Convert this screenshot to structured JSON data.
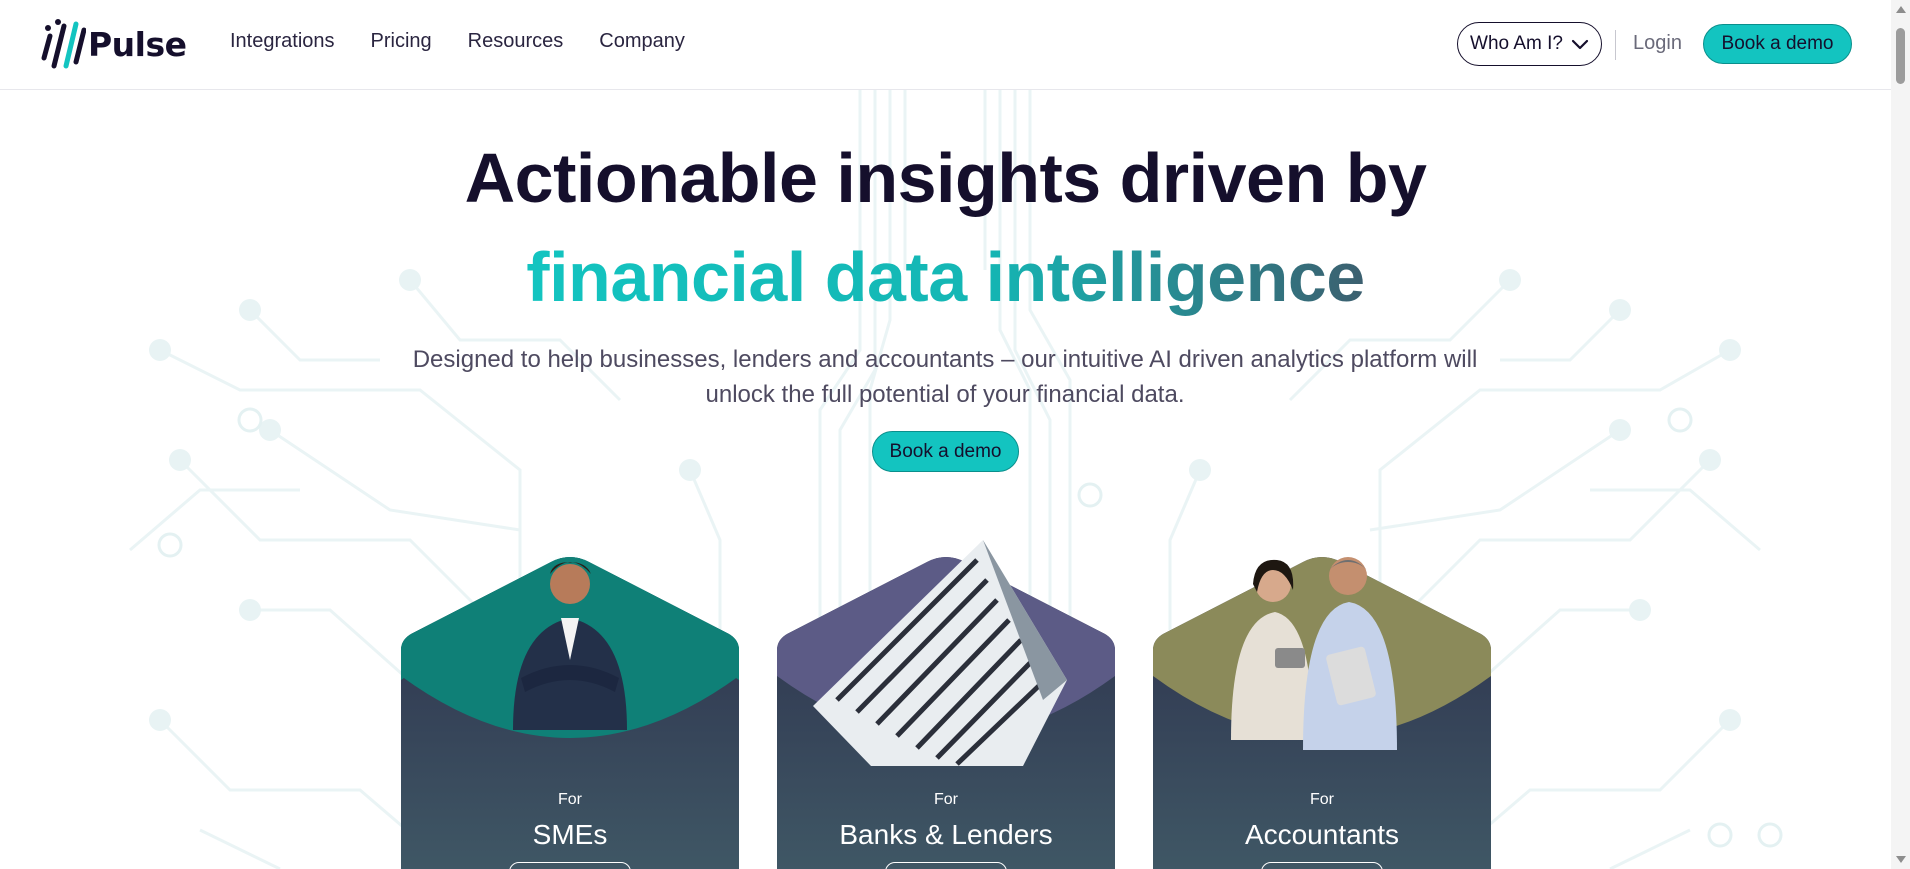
{
  "brand": {
    "name": "Pulse"
  },
  "nav": {
    "links": [
      "Integrations",
      "Pricing",
      "Resources",
      "Company"
    ],
    "who_am_i": "Who Am I?",
    "login": "Login",
    "book_demo": "Book a demo"
  },
  "hero": {
    "title_line1": "Actionable insights driven by",
    "title_line2": "financial data intelligence",
    "subtitle_line1": "Designed to help businesses, lenders and accountants – our intuitive AI driven analytics platform will",
    "subtitle_line2": "unlock the full potential of your financial data.",
    "book_demo": "Book a demo"
  },
  "cards": [
    {
      "for": "For",
      "name": "SMEs",
      "accent": "#0f8077"
    },
    {
      "for": "For",
      "name": "Banks & Lenders",
      "accent": "#5c5b86"
    },
    {
      "for": "For",
      "name": "Accountants",
      "accent": "#8b8a5a"
    }
  ],
  "colors": {
    "primary": "#13c4c0",
    "dark": "#150f2c",
    "card_gradient_top": "#2c2f4b",
    "card_gradient_bottom": "#3f5765"
  }
}
